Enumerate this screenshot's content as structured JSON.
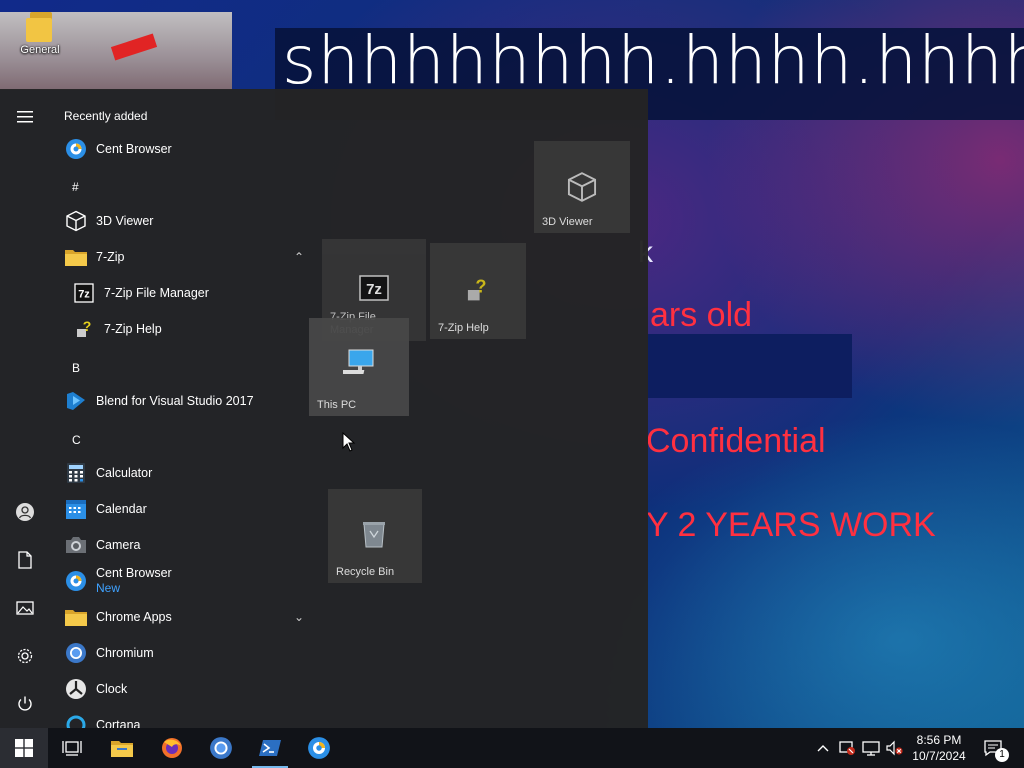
{
  "desktop": {
    "icon_label": "General",
    "wallpaper_texts": {
      "top": "shhhhhhhh.hhhh.hhhh",
      "k": "k",
      "years": "ars old",
      "confidential": "Confidential",
      "work": "Y 2 YEARS WORK"
    }
  },
  "start_menu": {
    "header": "Recently added",
    "items": [
      {
        "label": "Cent Browser",
        "icon": "cent-browser-icon"
      },
      {
        "letter": "#"
      },
      {
        "label": "3D Viewer",
        "icon": "3d-viewer-icon"
      },
      {
        "label": "7-Zip",
        "icon": "folder-icon",
        "expanded": true
      },
      {
        "label": "7-Zip File Manager",
        "icon": "7zip-icon"
      },
      {
        "label": "7-Zip Help",
        "icon": "help-icon"
      },
      {
        "letter": "B"
      },
      {
        "label": "Blend for Visual Studio 2017",
        "icon": "blend-icon"
      },
      {
        "letter": "C"
      },
      {
        "label": "Calculator",
        "icon": "calculator-icon"
      },
      {
        "label": "Calendar",
        "icon": "calendar-icon"
      },
      {
        "label": "Camera",
        "icon": "camera-icon"
      },
      {
        "label": "Cent Browser",
        "badge": "New",
        "icon": "cent-browser-icon"
      },
      {
        "label": "Chrome Apps",
        "icon": "folder-icon",
        "expanded": false
      },
      {
        "label": "Chromium",
        "icon": "chromium-icon"
      },
      {
        "label": "Clock",
        "icon": "clock-icon"
      },
      {
        "label": "Cortana",
        "icon": "cortana-icon"
      }
    ],
    "tiles": [
      {
        "label": "3D Viewer"
      },
      {
        "label": "7-Zip File Manager"
      },
      {
        "label": "7-Zip Help"
      },
      {
        "label": "This PC"
      },
      {
        "label": "Recycle Bin"
      }
    ]
  },
  "taskbar": {
    "time": "8:56 PM",
    "date": "10/7/2024",
    "notification_count": "1"
  },
  "colors": {
    "accent": "#76b9ed",
    "new_badge": "#3fa2ff",
    "start_bg": "#242424",
    "taskbar_bg": "#111318"
  }
}
